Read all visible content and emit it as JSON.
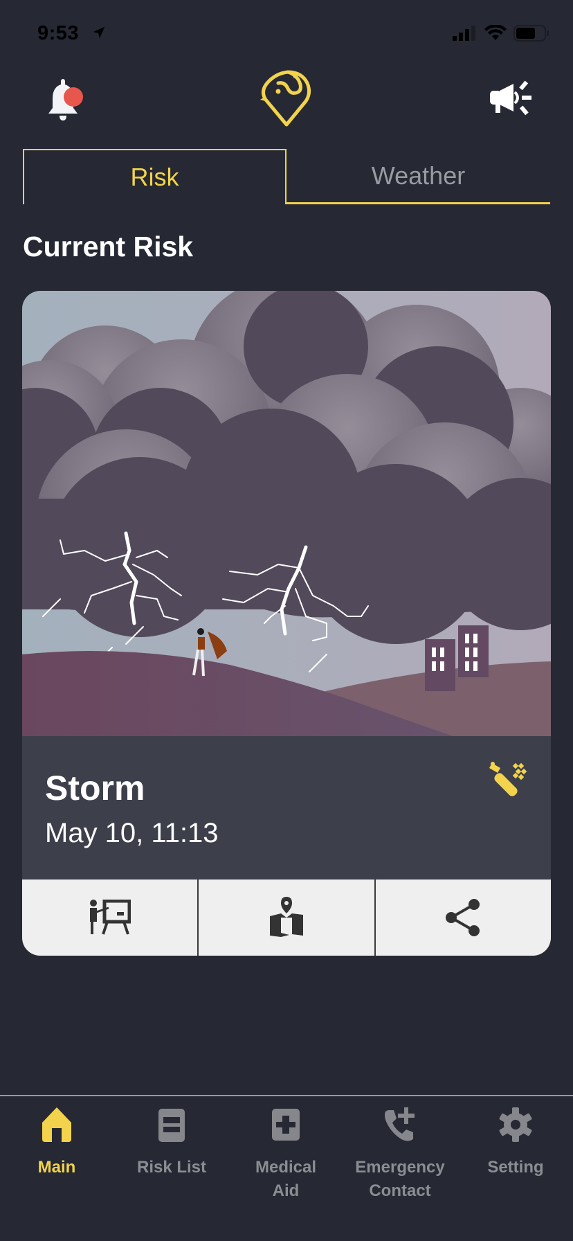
{
  "status_bar": {
    "time": "9:53",
    "icons": [
      "location-arrow-icon",
      "cellular-signal-icon",
      "wifi-icon",
      "battery-icon"
    ]
  },
  "header": {
    "left_icon": "bell-icon",
    "notification_badge_color": "#E8574E",
    "logo_icon": "bird-pin-logo",
    "right_icon": "megaphone-icon"
  },
  "tabs": [
    {
      "label": "Risk",
      "active": true
    },
    {
      "label": "Weather",
      "active": false
    }
  ],
  "section_title": "Current Risk",
  "risk_card": {
    "illustration": "storm-scene",
    "name": "Storm",
    "date": "May 10, 11:13",
    "source_icon": "satellite-icon",
    "actions": [
      {
        "icon": "presentation-icon",
        "name": "guide"
      },
      {
        "icon": "map-pin-icon",
        "name": "map"
      },
      {
        "icon": "share-icon",
        "name": "share"
      }
    ]
  },
  "tabbar": {
    "items": [
      {
        "label": "Main",
        "icon": "home-icon",
        "active": true
      },
      {
        "label": "Risk List",
        "icon": "list-icon",
        "active": false
      },
      {
        "label": "Medical\nAid",
        "label_line1": "Medical",
        "label_line2": "Aid",
        "icon": "medical-cross-icon",
        "active": false
      },
      {
        "label": "Emergency\nContact",
        "label_line1": "Emergency",
        "label_line2": "Contact",
        "icon": "phone-add-icon",
        "active": false
      },
      {
        "label": "Setting",
        "icon": "gear-icon",
        "active": false
      }
    ]
  },
  "colors": {
    "accent": "#F2D34B",
    "background": "#262833",
    "card": "#3d3f4a",
    "inactive": "#8c8d93"
  }
}
